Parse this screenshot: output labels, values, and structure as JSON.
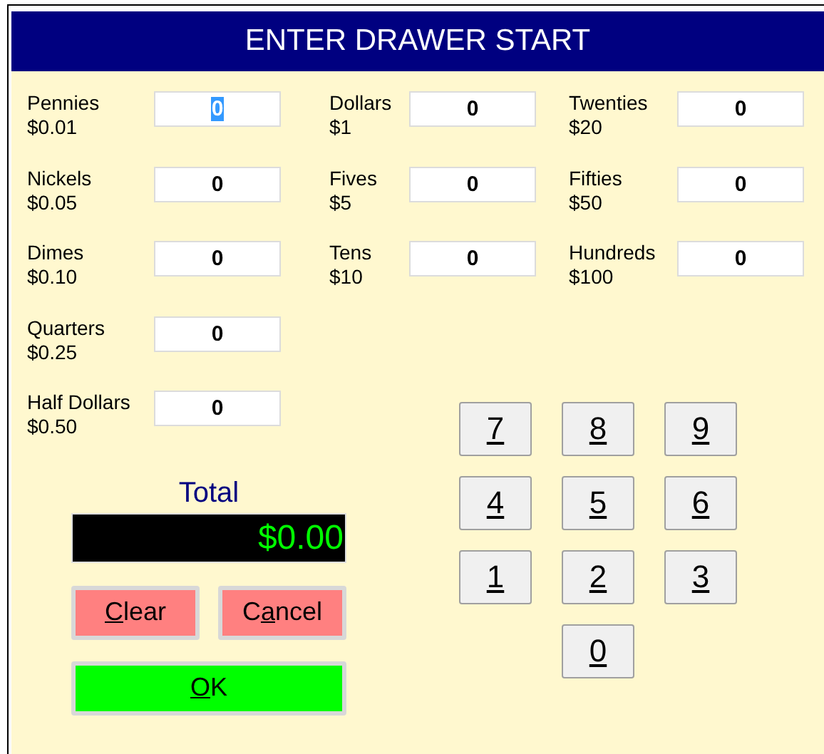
{
  "window": {
    "title": "ENTER DRAWER START"
  },
  "columns": [
    {
      "denominations": [
        {
          "name": "Pennies",
          "amount": "$0.01",
          "count": "0",
          "selected": true
        },
        {
          "name": "Nickels",
          "amount": "$0.05",
          "count": "0",
          "selected": false
        },
        {
          "name": "Dimes",
          "amount": "$0.10",
          "count": "0",
          "selected": false
        },
        {
          "name": "Quarters",
          "amount": "$0.25",
          "count": "0",
          "selected": false
        },
        {
          "name": "Half Dollars",
          "amount": "$0.50",
          "count": "0",
          "selected": false
        }
      ]
    },
    {
      "denominations": [
        {
          "name": "Dollars",
          "amount": "$1",
          "count": "0",
          "selected": false
        },
        {
          "name": "Fives",
          "amount": "$5",
          "count": "0",
          "selected": false
        },
        {
          "name": "Tens",
          "amount": "$10",
          "count": "0",
          "selected": false
        }
      ]
    },
    {
      "denominations": [
        {
          "name": "Twenties",
          "amount": "$20",
          "count": "0",
          "selected": false
        },
        {
          "name": "Fifties",
          "amount": "$50",
          "count": "0",
          "selected": false
        },
        {
          "name": "Hundreds",
          "amount": "$100",
          "count": "0",
          "selected": false
        }
      ]
    }
  ],
  "total": {
    "label": "Total",
    "amount": "$0.00"
  },
  "actions": [
    {
      "kind": "clear",
      "key": "C",
      "post": "lear"
    },
    {
      "kind": "cancel",
      "pre": "C",
      "key": "a",
      "post": "ncel"
    },
    {
      "kind": "ok",
      "key": "O",
      "post": "K"
    }
  ],
  "keypad": [
    {
      "key": "7"
    },
    {
      "key": "8"
    },
    {
      "key": "9"
    },
    {
      "key": "4"
    },
    {
      "key": "5"
    },
    {
      "key": "6"
    },
    {
      "key": "1"
    },
    {
      "key": "2"
    },
    {
      "key": "3"
    },
    {
      "key": "0"
    }
  ]
}
